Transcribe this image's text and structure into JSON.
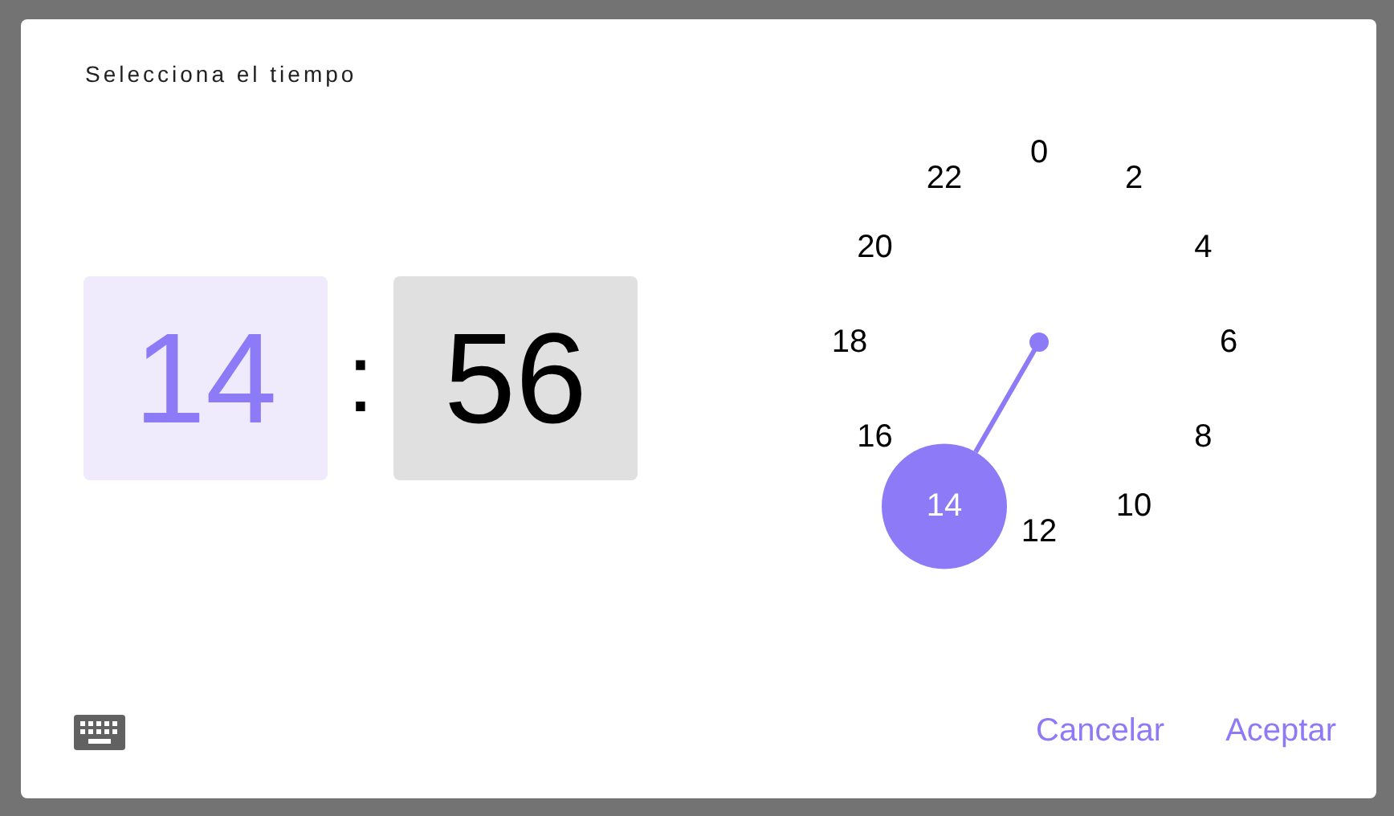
{
  "dialog": {
    "title": "Selecciona el tiempo"
  },
  "time": {
    "hour": {
      "value": "14",
      "selected": true
    },
    "separator": ":",
    "minute": {
      "value": "56",
      "selected": false
    }
  },
  "dial": {
    "labels": [
      {
        "label": "0",
        "selected": false
      },
      {
        "label": "2",
        "selected": false
      },
      {
        "label": "4",
        "selected": false
      },
      {
        "label": "6",
        "selected": false
      },
      {
        "label": "8",
        "selected": false
      },
      {
        "label": "10",
        "selected": false
      },
      {
        "label": "12",
        "selected": false
      },
      {
        "label": "14",
        "selected": true
      },
      {
        "label": "16",
        "selected": false
      },
      {
        "label": "18",
        "selected": false
      },
      {
        "label": "20",
        "selected": false
      },
      {
        "label": "22",
        "selected": false
      }
    ]
  },
  "buttons": [
    {
      "label": "Cancelar"
    },
    {
      "label": "Aceptar"
    }
  ]
}
